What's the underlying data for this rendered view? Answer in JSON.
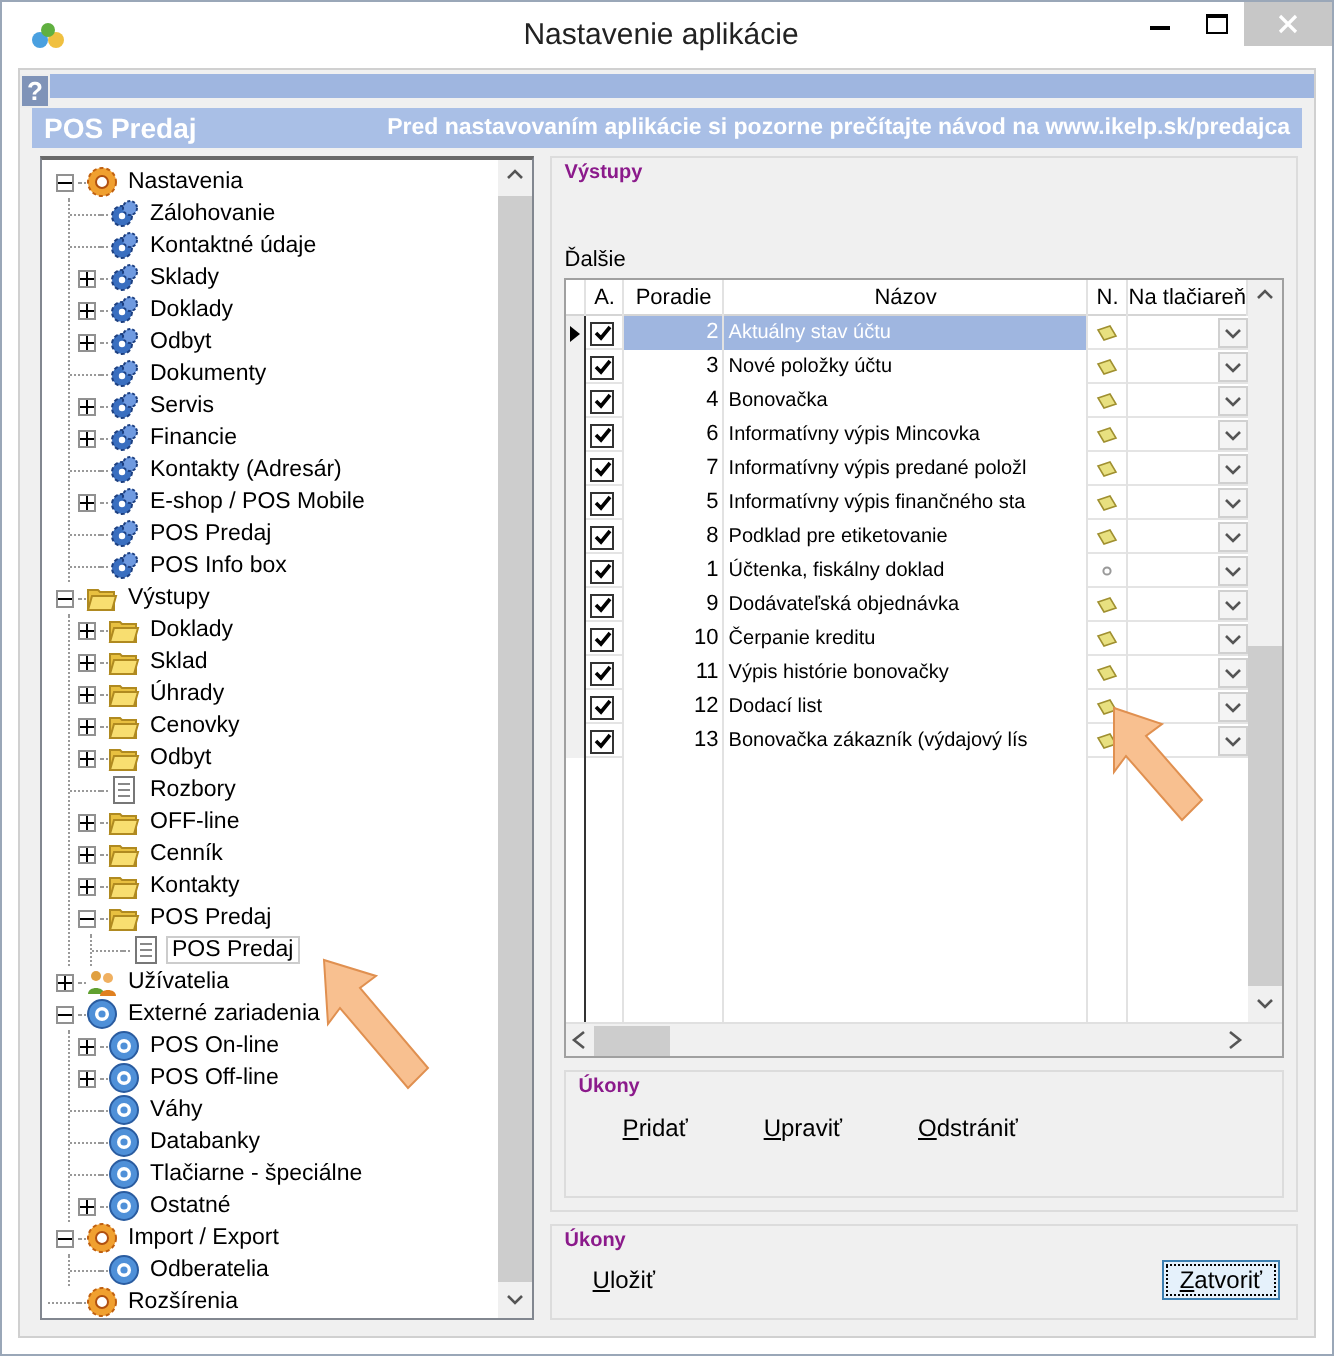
{
  "window": {
    "title": "Nastavenie aplikácie"
  },
  "header": {
    "title": "POS Predaj",
    "notice": "Pred nastavovaním aplikácie si pozorne prečítajte návod na www.ikelp.sk/predajca",
    "help": "?"
  },
  "tree": [
    {
      "label": "Nastavenia",
      "kind": "settings",
      "expanded": true,
      "children": [
        {
          "label": "Zálohovanie",
          "kind": "module"
        },
        {
          "label": "Kontaktné údaje",
          "kind": "module"
        },
        {
          "label": "Sklady",
          "kind": "module",
          "expanded": false
        },
        {
          "label": "Doklady",
          "kind": "module",
          "expanded": false
        },
        {
          "label": "Odbyt",
          "kind": "module",
          "expanded": false
        },
        {
          "label": "Dokumenty",
          "kind": "module"
        },
        {
          "label": "Servis",
          "kind": "module",
          "expanded": false
        },
        {
          "label": "Financie",
          "kind": "module",
          "expanded": false
        },
        {
          "label": "Kontakty (Adresár)",
          "kind": "module"
        },
        {
          "label": "E-shop / POS Mobile",
          "kind": "module",
          "expanded": false
        },
        {
          "label": "POS Predaj",
          "kind": "module"
        },
        {
          "label": "POS Info box",
          "kind": "module"
        }
      ]
    },
    {
      "label": "Výstupy",
      "kind": "folder",
      "expanded": true,
      "children": [
        {
          "label": "Doklady",
          "kind": "folder",
          "expanded": false
        },
        {
          "label": "Sklad",
          "kind": "folder",
          "expanded": false
        },
        {
          "label": "Úhrady",
          "kind": "folder",
          "expanded": false
        },
        {
          "label": "Cenovky",
          "kind": "folder",
          "expanded": false
        },
        {
          "label": "Odbyt",
          "kind": "folder",
          "expanded": false
        },
        {
          "label": "Rozbory",
          "kind": "document"
        },
        {
          "label": "OFF-line",
          "kind": "folder",
          "expanded": false
        },
        {
          "label": "Cenník",
          "kind": "folder",
          "expanded": false
        },
        {
          "label": "Kontakty",
          "kind": "folder",
          "expanded": false
        },
        {
          "label": "POS Predaj",
          "kind": "folder",
          "expanded": true,
          "children": [
            {
              "label": "POS Predaj",
              "kind": "document",
              "selected": true
            }
          ]
        }
      ]
    },
    {
      "label": "Užívatelia",
      "kind": "users",
      "expanded": false
    },
    {
      "label": "Externé zariadenia",
      "kind": "device",
      "expanded": true,
      "children": [
        {
          "label": "POS On-line",
          "kind": "device",
          "expanded": false
        },
        {
          "label": "POS Off-line",
          "kind": "device",
          "expanded": false
        },
        {
          "label": "Váhy",
          "kind": "device"
        },
        {
          "label": "Databanky",
          "kind": "device"
        },
        {
          "label": "Tlačiarne - špeciálne",
          "kind": "device"
        },
        {
          "label": "Ostatné",
          "kind": "device",
          "expanded": false
        }
      ]
    },
    {
      "label": "Import / Export",
      "kind": "settings",
      "expanded": true,
      "children": [
        {
          "label": "Odberatelia",
          "kind": "device"
        }
      ]
    },
    {
      "label": "Rozšírenia",
      "kind": "settings"
    }
  ],
  "outputs": {
    "title": "Výstupy",
    "subtitle": "Ďalšie",
    "columns": [
      "A.",
      "Poradie",
      "Názov",
      "N.",
      "Na tlačiareň"
    ],
    "rows": [
      {
        "checked": true,
        "order": "2",
        "name": "Aktuálny stav účtu",
        "kind": "note",
        "selected": true
      },
      {
        "checked": true,
        "order": "3",
        "name": "Nové položky účtu",
        "kind": "note",
        "selected": false
      },
      {
        "checked": true,
        "order": "4",
        "name": "Bonovačka",
        "kind": "note",
        "selected": false
      },
      {
        "checked": true,
        "order": "6",
        "name": "Informatívny výpis Mincovka",
        "kind": "note",
        "selected": false
      },
      {
        "checked": true,
        "order": "7",
        "name": "Informatívny výpis predané položl",
        "kind": "note",
        "selected": false
      },
      {
        "checked": true,
        "order": "5",
        "name": "Informatívny výpis finančného sta",
        "kind": "note",
        "selected": false
      },
      {
        "checked": true,
        "order": "8",
        "name": "Podklad pre etiketovanie",
        "kind": "note",
        "selected": false
      },
      {
        "checked": true,
        "order": "1",
        "name": "Účtenka, fiskálny doklad",
        "kind": "plain",
        "selected": false
      },
      {
        "checked": true,
        "order": "9",
        "name": "Dodávateľská objednávka",
        "kind": "note",
        "selected": false
      },
      {
        "checked": true,
        "order": "10",
        "name": "Čerpanie kreditu",
        "kind": "note",
        "selected": false
      },
      {
        "checked": true,
        "order": "11",
        "name": "Výpis histórie bonovačky",
        "kind": "note",
        "selected": false
      },
      {
        "checked": true,
        "order": "12",
        "name": "Dodací list",
        "kind": "note",
        "selected": false
      },
      {
        "checked": true,
        "order": "13",
        "name": "Bonovačka zákazník (výdajový lís",
        "kind": "note",
        "selected": false
      }
    ],
    "actions_title": "Úkony",
    "actions": [
      "Pridať",
      "Upraviť",
      "Odstrániť"
    ]
  },
  "footer": {
    "title": "Úkony",
    "save": "Uložiť",
    "close": "Zatvoriť"
  }
}
